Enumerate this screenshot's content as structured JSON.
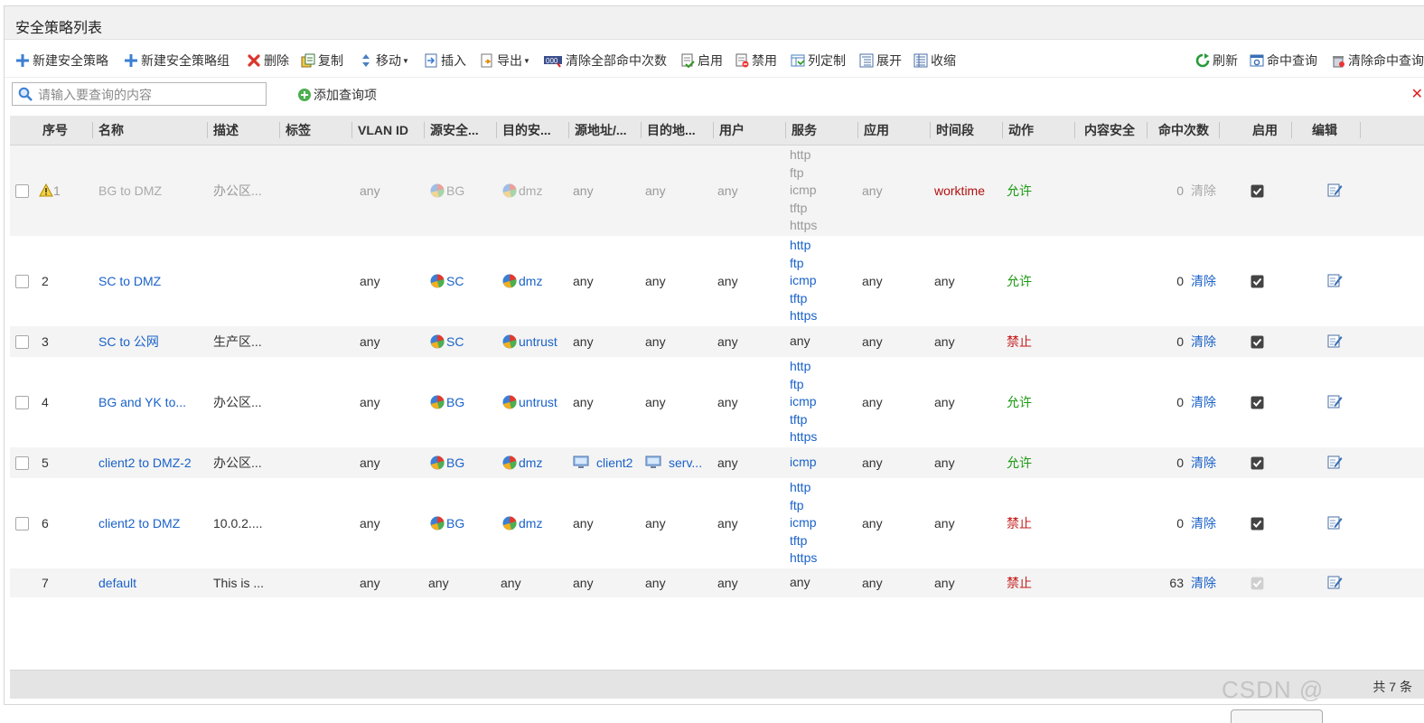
{
  "panel": {
    "title": "安全策略列表"
  },
  "toolbar": {
    "new_policy": "新建安全策略",
    "new_group": "新建安全策略组",
    "delete": "删除",
    "copy": "复制",
    "move": "移动",
    "insert": "插入",
    "export": "导出",
    "clear_all_hits": "清除全部命中次数",
    "enable": "启用",
    "disable": "禁用",
    "customize_columns": "列定制",
    "expand": "展开",
    "collapse": "收缩",
    "refresh": "刷新",
    "hit_query": "命中查询",
    "clear_hit_query": "清除命中查询"
  },
  "search": {
    "placeholder": "请输入要查询的内容",
    "add_query": "添加查询项"
  },
  "columns": [
    "序号",
    "名称",
    "描述",
    "标签",
    "VLAN ID",
    "源安全...",
    "目的安...",
    "源地址/...",
    "目的地...",
    "用户",
    "服务",
    "应用",
    "时间段",
    "动作",
    "内容安全",
    "命中次数",
    "启用",
    "编辑"
  ],
  "colors": {
    "link": "#1a62c9",
    "allow": "#1b9a12",
    "deny": "#c41b1b",
    "header_bg": "#e9e9e9",
    "row_alt": "#f4f4f4"
  },
  "rows": [
    {
      "id": "1",
      "name": "BG to DMZ",
      "desc": "办公区...",
      "vlan": "any",
      "src_zone": "BG",
      "dst_zone": "dmz",
      "src_addr": "any",
      "dst_addr": "any",
      "user": "any",
      "services": [
        "http",
        "ftp",
        "icmp",
        "tftp",
        "https"
      ],
      "app": "any",
      "time": "worktime",
      "action": "允许",
      "hits": "0",
      "clear": "清除",
      "enabled": true
    },
    {
      "id": "2",
      "name": "SC to DMZ",
      "desc": "",
      "vlan": "any",
      "src_zone": "SC",
      "dst_zone": "dmz",
      "src_addr": "any",
      "dst_addr": "any",
      "user": "any",
      "services": [
        "http",
        "ftp",
        "icmp",
        "tftp",
        "https"
      ],
      "app": "any",
      "time": "any",
      "action": "允许",
      "hits": "0",
      "clear": "清除",
      "enabled": true
    },
    {
      "id": "3",
      "name": "SC to 公网",
      "desc": "生产区...",
      "vlan": "any",
      "src_zone": "SC",
      "dst_zone": "untrust",
      "src_addr": "any",
      "dst_addr": "any",
      "user": "any",
      "services": [
        "any"
      ],
      "app": "any",
      "time": "any",
      "action": "禁止",
      "hits": "0",
      "clear": "清除",
      "enabled": true
    },
    {
      "id": "4",
      "name": "BG and YK to...",
      "desc": "办公区...",
      "vlan": "any",
      "src_zone": "BG",
      "dst_zone": "untrust",
      "src_addr": "any",
      "dst_addr": "any",
      "user": "any",
      "services": [
        "http",
        "ftp",
        "icmp",
        "tftp",
        "https"
      ],
      "app": "any",
      "time": "any",
      "action": "允许",
      "hits": "0",
      "clear": "清除",
      "enabled": true
    },
    {
      "id": "5",
      "name": "client2 to DMZ-2",
      "desc": "办公区...",
      "vlan": "any",
      "src_zone": "BG",
      "dst_zone": "dmz",
      "src_addr": "client2",
      "dst_addr": "serv...",
      "user": "any",
      "services": [
        "icmp"
      ],
      "app": "any",
      "time": "any",
      "action": "允许",
      "hits": "0",
      "clear": "清除",
      "enabled": true
    },
    {
      "id": "6",
      "name": "client2 to DMZ",
      "desc": "10.0.2....",
      "vlan": "any",
      "src_zone": "BG",
      "dst_zone": "dmz",
      "src_addr": "any",
      "dst_addr": "any",
      "user": "any",
      "services": [
        "http",
        "ftp",
        "icmp",
        "tftp",
        "https"
      ],
      "app": "any",
      "time": "any",
      "action": "禁止",
      "hits": "0",
      "clear": "清除",
      "enabled": true
    },
    {
      "id": "7",
      "name": "default",
      "desc": "This is ...",
      "vlan": "any",
      "src_zone": "any",
      "dst_zone": "any",
      "src_addr": "any",
      "dst_addr": "any",
      "user": "any",
      "services": [
        "any"
      ],
      "app": "any",
      "time": "any",
      "action": "禁止",
      "hits": "63",
      "clear": "清除",
      "enabled": true
    }
  ],
  "footer": {
    "total": "共 7 条"
  },
  "watermark": "CSDN @"
}
